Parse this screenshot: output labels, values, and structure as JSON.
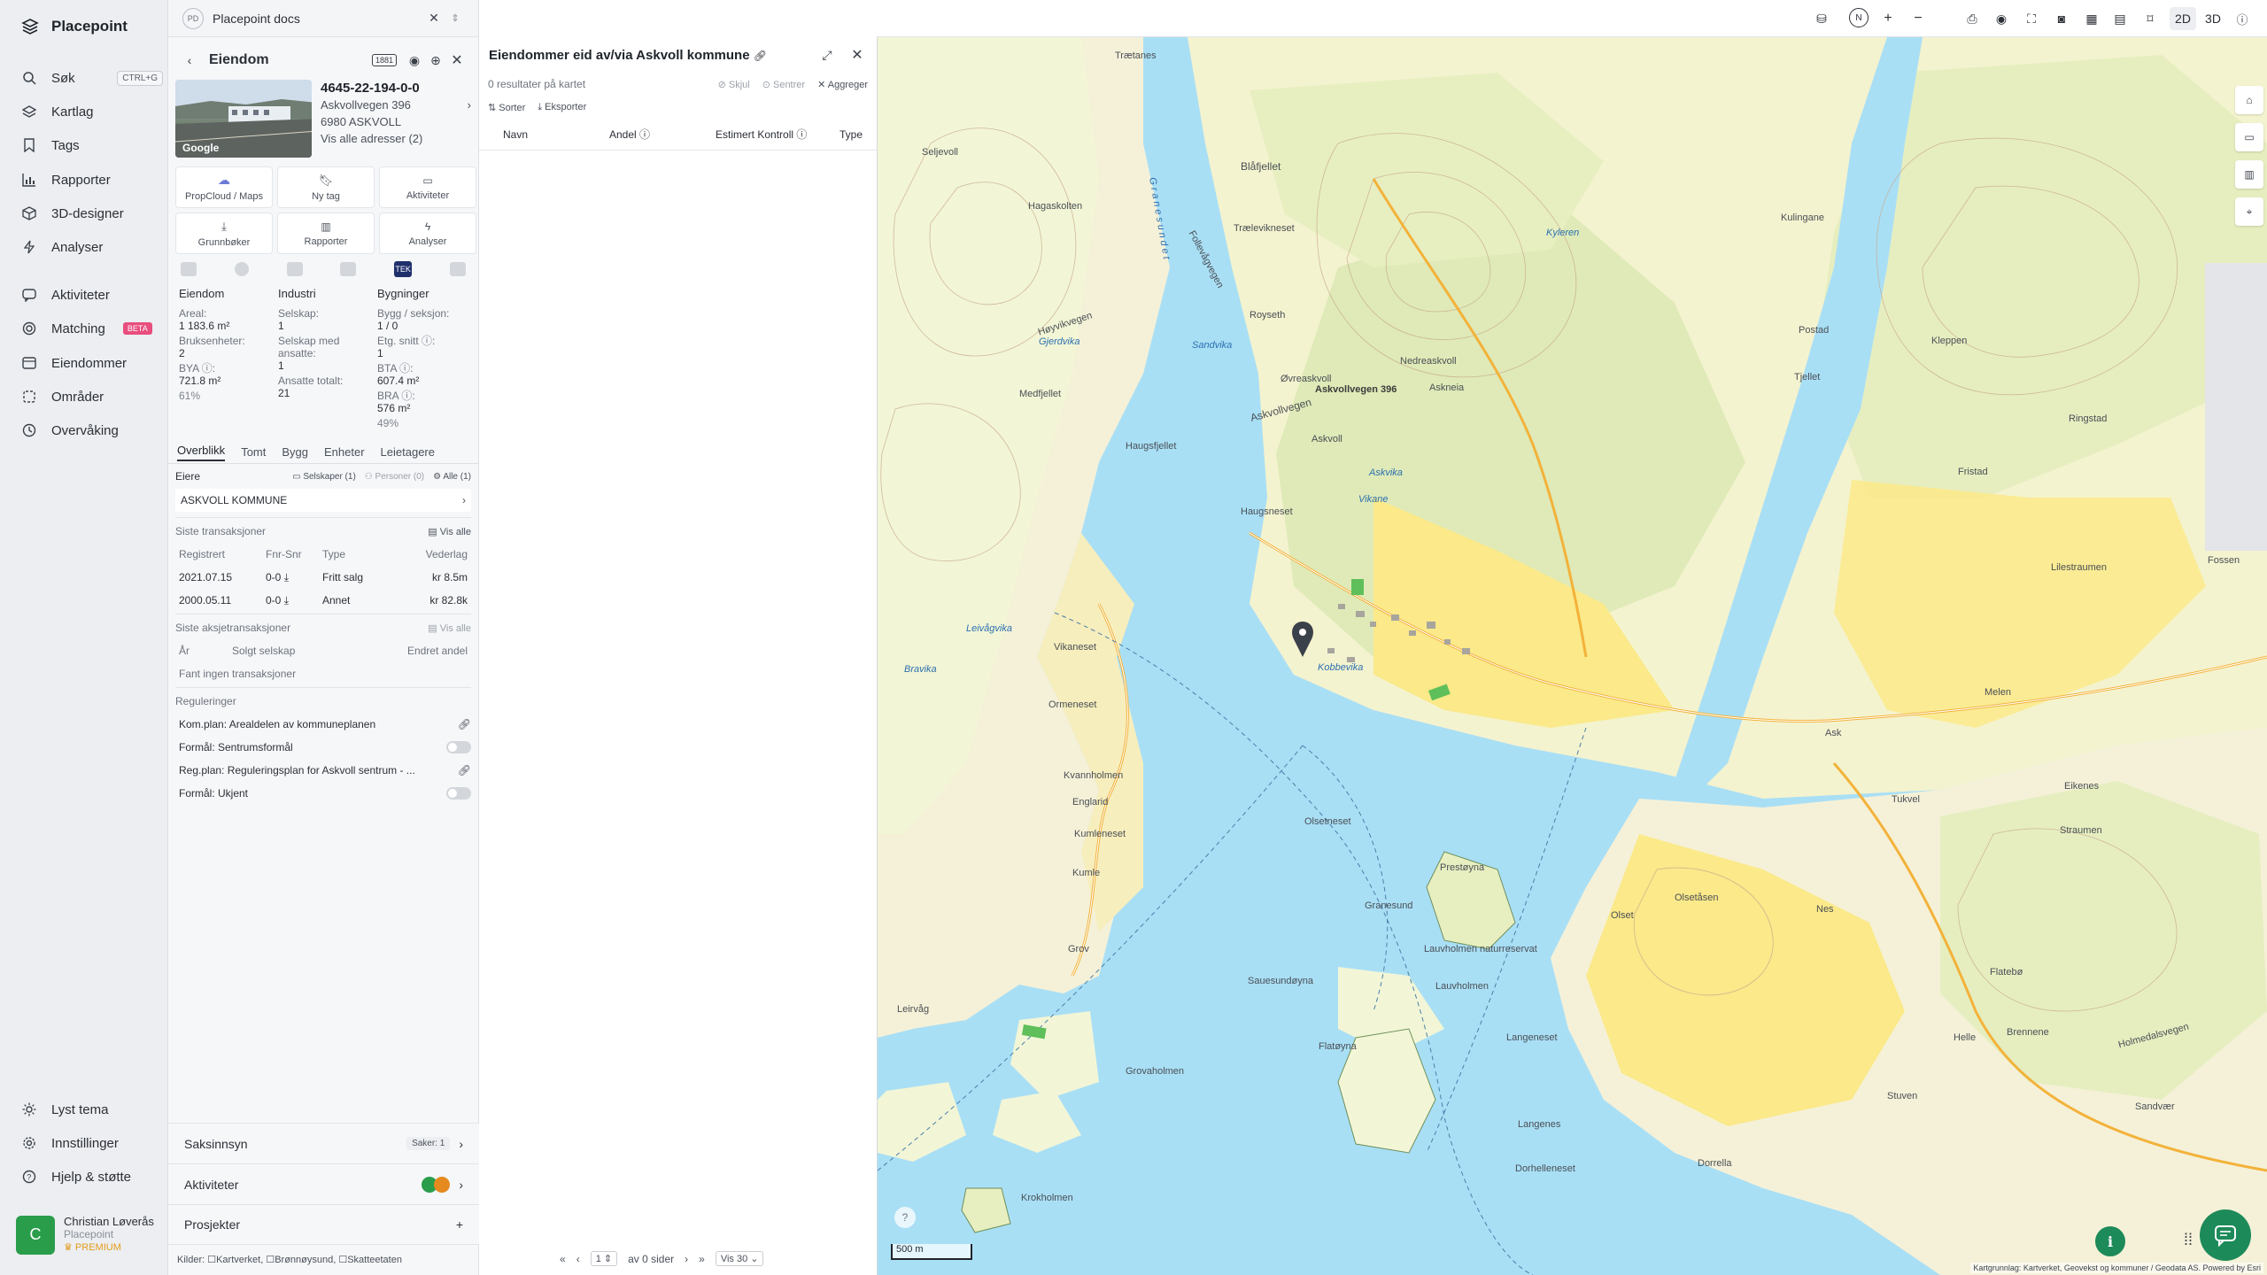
{
  "nav": {
    "brand": "Placepoint",
    "items": [
      {
        "label": "Søk",
        "icon": "search-icon",
        "shortcut": "CTRL+G"
      },
      {
        "label": "Kartlag",
        "icon": "layers-icon"
      },
      {
        "label": "Tags",
        "icon": "bookmark-icon"
      },
      {
        "label": "Rapporter",
        "icon": "chart-icon"
      },
      {
        "label": "3D-designer",
        "icon": "cube-icon"
      },
      {
        "label": "Analyser",
        "icon": "bolt-icon"
      },
      {
        "label": "Aktiviteter",
        "icon": "chat-icon"
      },
      {
        "label": "Matching",
        "icon": "target-icon",
        "badge": "BETA"
      },
      {
        "label": "Eiendommer",
        "icon": "table-icon"
      },
      {
        "label": "Områder",
        "icon": "area-icon"
      },
      {
        "label": "Overvåking",
        "icon": "monitor-icon"
      }
    ],
    "bottom_items": [
      {
        "label": "Lyst tema",
        "icon": "sun-icon"
      },
      {
        "label": "Innstillinger",
        "icon": "gear-icon"
      },
      {
        "label": "Hjelp & støtte",
        "icon": "help-icon"
      }
    ],
    "user": {
      "initial": "C",
      "name": "Christian Løverås",
      "org": "Placepoint",
      "tier": "PREMIUM"
    }
  },
  "panel": {
    "tab_title": "Placepoint docs",
    "tab_logo": "PD",
    "header_title": "Eiendom",
    "badge": "1881",
    "property": {
      "id": "4645-22-194-0-0",
      "street": "Askvollvegen 396",
      "postcode": "6980 ASKVOLL",
      "all_addresses": "Vis alle adresser (2)",
      "photo_credit": "Google"
    },
    "actions": [
      {
        "label": "PropCloud / Maps",
        "icon": "cloud-icon"
      },
      {
        "label": "Ny tag",
        "icon": "bookmark-icon"
      },
      {
        "label": "Aktiviteter",
        "icon": "chat-icon"
      },
      {
        "label": "Grunnbøker",
        "icon": "download-icon"
      },
      {
        "label": "Rapporter",
        "icon": "chart-icon"
      },
      {
        "label": "Analyser",
        "icon": "bolt-icon"
      }
    ],
    "tek_label": "TEK",
    "stats": {
      "eiendom": {
        "head": "Eiendom",
        "areal_label": "Areal:",
        "areal": "1 183.6 m²",
        "bruksenheter_label": "Bruksenheter:",
        "bruksenheter": "2",
        "bya_label": "BYA ⓘ:",
        "bya": "721.8 m²",
        "bya_pct": "61%"
      },
      "industri": {
        "head": "Industri",
        "selskap_label": "Selskap:",
        "selskap": "1",
        "med_ansatte_label": "Selskap med ansatte:",
        "med_ansatte": "1",
        "ansatte_label": "Ansatte totalt:",
        "ansatte": "21"
      },
      "bygninger": {
        "head": "Bygninger",
        "bygg_label": "Bygg / seksjon:",
        "bygg": "1 / 0",
        "etg_label": "Etg. snitt ⓘ:",
        "etg": "1",
        "bta_label": "BTA ⓘ:",
        "bta": "607.4 m²",
        "bra_label": "BRA ⓘ:",
        "bra": "576 m²",
        "bra_pct": "49%"
      }
    },
    "tabs": [
      "Overblikk",
      "Tomt",
      "Bygg",
      "Enheter",
      "Leietagere"
    ],
    "eiere": {
      "label": "Eiere",
      "filters": [
        "Selskaper (1)",
        "Personer (0)",
        "Alle (1)"
      ],
      "owner": "ASKVOLL KOMMUNE"
    },
    "transaksjoner": {
      "title": "Siste transaksjoner",
      "vis_alle": "Vis alle",
      "headers": [
        "Registrert",
        "Fnr-Snr",
        "Type",
        "Vederlag"
      ],
      "rows": [
        [
          "2021.07.15",
          "0-0",
          "Fritt salg",
          "kr 8.5m"
        ],
        [
          "2000.05.11",
          "0-0",
          "Annet",
          "kr 82.8k"
        ]
      ]
    },
    "aksjetransaksjoner": {
      "title": "Siste aksjetransaksjoner",
      "vis_alle": "Vis alle",
      "headers": [
        "År",
        "Solgt selskap",
        "Endret andel"
      ],
      "empty": "Fant ingen transaksjoner"
    },
    "reguleringer": {
      "title": "Reguleringer",
      "items": [
        {
          "label": "Kom.plan: Arealdelen av kommuneplanen",
          "kind": "link"
        },
        {
          "label": "Formål: Sentrumsformål",
          "kind": "toggle"
        },
        {
          "label": "Reg.plan: Reguleringsplan for Askvoll sentrum - ...",
          "kind": "link"
        },
        {
          "label": "Formål: Ukjent",
          "kind": "toggle"
        }
      ]
    },
    "saksinnsyn": {
      "label": "Saksinnsyn",
      "count": "Saker: 1"
    },
    "aktiviteter_label": "Aktiviteter",
    "prosjekter_label": "Prosjekter",
    "sources": "Kilder: ☐Kartverket, ☐Brønnøysund, ☐Skatteetaten"
  },
  "results": {
    "title": "Eiendommer eid av/via Askvoll kommune",
    "count_text": "0 resultater på kartet",
    "hide": "Skjul",
    "center": "Sentrer",
    "aggregate": "Aggreger",
    "sort": "Sorter",
    "export": "Eksporter",
    "columns": [
      "Navn",
      "Andel ⓘ",
      "Estimert Kontroll ⓘ",
      "Type"
    ],
    "pager": {
      "page": "1",
      "of_text": "av 0 sider",
      "per_page": "Vis 30"
    }
  },
  "map": {
    "view_2d": "2D",
    "view_3d": "3D",
    "scale": "500 m",
    "marker_label": "Askvollvegen 396",
    "attribution": "Kartgrunnlag: Kartverket, Geovekst og kommuner / Geodata AS. Powered by Esri",
    "place_labels": [
      {
        "t": "Sandvika",
        "type": "water"
      },
      {
        "t": "Gjerdvika",
        "type": "water"
      },
      {
        "t": "Askvika",
        "type": "water"
      },
      {
        "t": "Kyleren",
        "type": "water"
      },
      {
        "t": "Leivågvika",
        "type": "water"
      },
      {
        "t": "Bravika",
        "type": "water"
      },
      {
        "t": "Kobbevika",
        "type": "water"
      },
      {
        "t": "Vikane",
        "type": "water"
      },
      {
        "t": "Granesundet",
        "type": "water"
      },
      {
        "t": "Askvoll",
        "type": "land"
      },
      {
        "t": "Trætanes",
        "type": "land"
      },
      {
        "t": "Blåfjellet",
        "type": "land"
      },
      {
        "t": "Høyvikvegen",
        "type": "land"
      },
      {
        "t": "Askvollvegen",
        "type": "land"
      },
      {
        "t": "Follevågvegen",
        "type": "land"
      },
      {
        "t": "Øvreaskvoll",
        "type": "land"
      },
      {
        "t": "Nedreaskvoll",
        "type": "land"
      },
      {
        "t": "Askneia",
        "type": "land"
      },
      {
        "t": "Royseth",
        "type": "land"
      },
      {
        "t": "Vikaneset",
        "type": "land"
      },
      {
        "t": "Ormeneset",
        "type": "land"
      },
      {
        "t": "Kvannholmen",
        "type": "land"
      },
      {
        "t": "Kumleneset",
        "type": "land"
      },
      {
        "t": "Olsetneset",
        "type": "land"
      },
      {
        "t": "Granesund",
        "type": "land"
      },
      {
        "t": "Prestøyna",
        "type": "land"
      },
      {
        "t": "Lauvholmen",
        "type": "land"
      },
      {
        "t": "Sauesundøyna",
        "type": "land"
      },
      {
        "t": "Flatøyna",
        "type": "land"
      },
      {
        "t": "Grovaholmen",
        "type": "land"
      },
      {
        "t": "Krokholmen",
        "type": "land"
      },
      {
        "t": "Langeneset",
        "type": "land"
      },
      {
        "t": "Langenes",
        "type": "land"
      },
      {
        "t": "Dorrella",
        "type": "land"
      },
      {
        "t": "Dorhelleneset",
        "type": "land"
      },
      {
        "t": "Olset",
        "type": "land"
      },
      {
        "t": "Olsetåsen",
        "type": "land"
      },
      {
        "t": "Nes",
        "type": "land"
      },
      {
        "t": "Flatebø",
        "type": "land"
      },
      {
        "t": "Brennene",
        "type": "land"
      },
      {
        "t": "Holmedalsvegen",
        "type": "land"
      },
      {
        "t": "Helle",
        "type": "land"
      },
      {
        "t": "Stuven",
        "type": "land"
      },
      {
        "t": "Ask",
        "type": "land"
      },
      {
        "t": "Tukvel",
        "type": "land"
      },
      {
        "t": "Melen",
        "type": "land"
      },
      {
        "t": "Eikenes",
        "type": "land"
      },
      {
        "t": "Straumen",
        "type": "land"
      },
      {
        "t": "Fossen",
        "type": "land"
      },
      {
        "t": "Lilestraumen",
        "type": "land"
      },
      {
        "t": "Fristad",
        "type": "land"
      },
      {
        "t": "Ringstad",
        "type": "land"
      },
      {
        "t": "Kleppen",
        "type": "land"
      },
      {
        "t": "Kulingane",
        "type": "land"
      },
      {
        "t": "Postad",
        "type": "land"
      },
      {
        "t": "Tjellet",
        "type": "land"
      },
      {
        "t": "Sandvær",
        "type": "land"
      },
      {
        "t": "Medfjellet",
        "type": "land"
      },
      {
        "t": "Haugsfjellet",
        "type": "land"
      },
      {
        "t": "Hagaskolten",
        "type": "land"
      },
      {
        "t": "Seljevoll",
        "type": "land"
      },
      {
        "t": "Englarid",
        "type": "land"
      },
      {
        "t": "Kumle",
        "type": "land"
      },
      {
        "t": "Grov",
        "type": "land"
      },
      {
        "t": "Leirvåg",
        "type": "land"
      },
      {
        "t": "Haugsneset",
        "type": "land"
      },
      {
        "t": "Trælevikneset",
        "type": "land"
      },
      {
        "t": "Lauvholmen naturreservat",
        "type": "land"
      }
    ]
  }
}
